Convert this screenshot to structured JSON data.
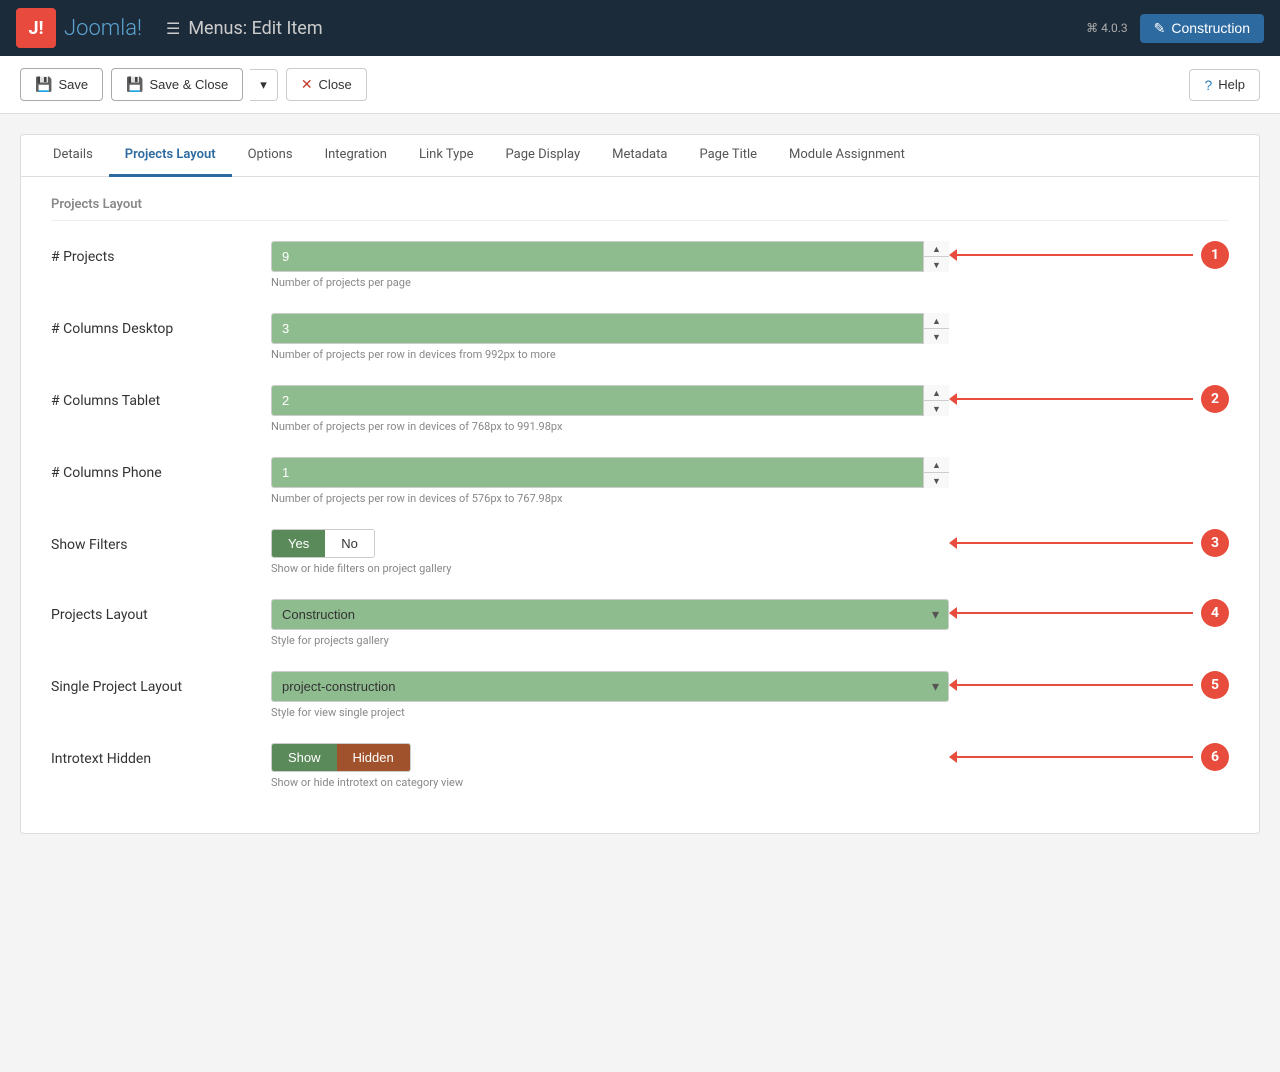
{
  "navbar": {
    "brand": "J!",
    "title": "Menus: Edit Item",
    "menu_icon": "☰",
    "version": "⌘ 4.0.3",
    "site_button": "Construction",
    "edit_icon": "✎"
  },
  "toolbar": {
    "save_label": "Save",
    "save_close_label": "Save & Close",
    "close_label": "Close",
    "help_label": "Help"
  },
  "tabs": [
    {
      "id": "details",
      "label": "Details",
      "active": false
    },
    {
      "id": "projects-layout",
      "label": "Projects Layout",
      "active": true
    },
    {
      "id": "options",
      "label": "Options",
      "active": false
    },
    {
      "id": "integration",
      "label": "Integration",
      "active": false
    },
    {
      "id": "link-type",
      "label": "Link Type",
      "active": false
    },
    {
      "id": "page-display",
      "label": "Page Display",
      "active": false
    },
    {
      "id": "metadata",
      "label": "Metadata",
      "active": false
    },
    {
      "id": "page-title",
      "label": "Page Title",
      "active": false
    },
    {
      "id": "module-assignment",
      "label": "Module Assignment",
      "active": false
    }
  ],
  "section_title": "Projects Layout",
  "fields": {
    "num_projects": {
      "label": "# Projects",
      "value": "9",
      "hint": "Number of projects per page",
      "annotation": "1"
    },
    "num_columns_desktop": {
      "label": "# Columns Desktop",
      "value": "3",
      "hint": "Number of projects per row in devices from 992px to more"
    },
    "num_columns_tablet": {
      "label": "# Columns Tablet",
      "value": "2",
      "hint": "Number of projects per row in devices of 768px to 991.98px",
      "annotation": "2"
    },
    "num_columns_phone": {
      "label": "# Columns Phone",
      "value": "1",
      "hint": "Number of projects per row in devices of 576px to 767.98px"
    },
    "show_filters": {
      "label": "Show Filters",
      "yes_label": "Yes",
      "no_label": "No",
      "hint": "Show or hide filters on project gallery",
      "annotation": "3"
    },
    "projects_layout": {
      "label": "Projects Layout",
      "value": "Construction",
      "hint": "Style for projects gallery",
      "annotation": "4"
    },
    "single_project_layout": {
      "label": "Single Project Layout",
      "value": "project-construction",
      "hint": "Style for view single project",
      "annotation": "5"
    },
    "introtext_hidden": {
      "label": "Introtext Hidden",
      "show_label": "Show",
      "hidden_label": "Hidden",
      "hint": "Show or hide introtext on category view",
      "annotation": "6"
    }
  }
}
